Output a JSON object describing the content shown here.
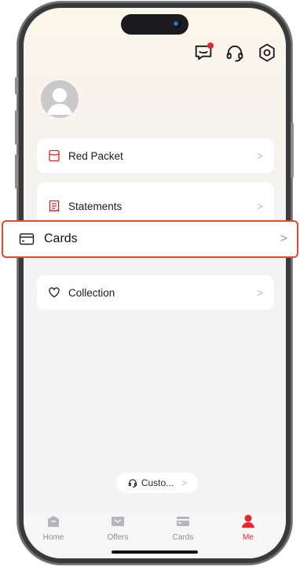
{
  "profile": {
    "menu_group_1": [
      {
        "label": "Red Packet",
        "icon": "red-packet-icon"
      }
    ],
    "menu_group_2": [
      {
        "label": "Statements",
        "icon": "statement-icon"
      },
      {
        "label": "Cards",
        "icon": "card-icon"
      }
    ],
    "menu_group_3": [
      {
        "label": "Collection",
        "icon": "heart-icon"
      }
    ],
    "highlight": {
      "label": "Cards",
      "icon": "card-icon"
    },
    "customer_service": {
      "label": "Custo...",
      "chevron": ">"
    }
  },
  "header_icons": [
    "message-icon",
    "headset-icon",
    "settings-icon"
  ],
  "tabbar": {
    "tabs": [
      {
        "label": "Home",
        "icon": "home-icon",
        "active": false
      },
      {
        "label": "Offers",
        "icon": "offers-icon",
        "active": false
      },
      {
        "label": "Cards",
        "icon": "card-icon",
        "active": false
      },
      {
        "label": "Me",
        "icon": "person-icon",
        "active": true
      }
    ]
  },
  "chevron": ">",
  "colors": {
    "accent": "#e8262d",
    "highlight_border": "#e24a2b",
    "background": "#f3f3f4"
  }
}
